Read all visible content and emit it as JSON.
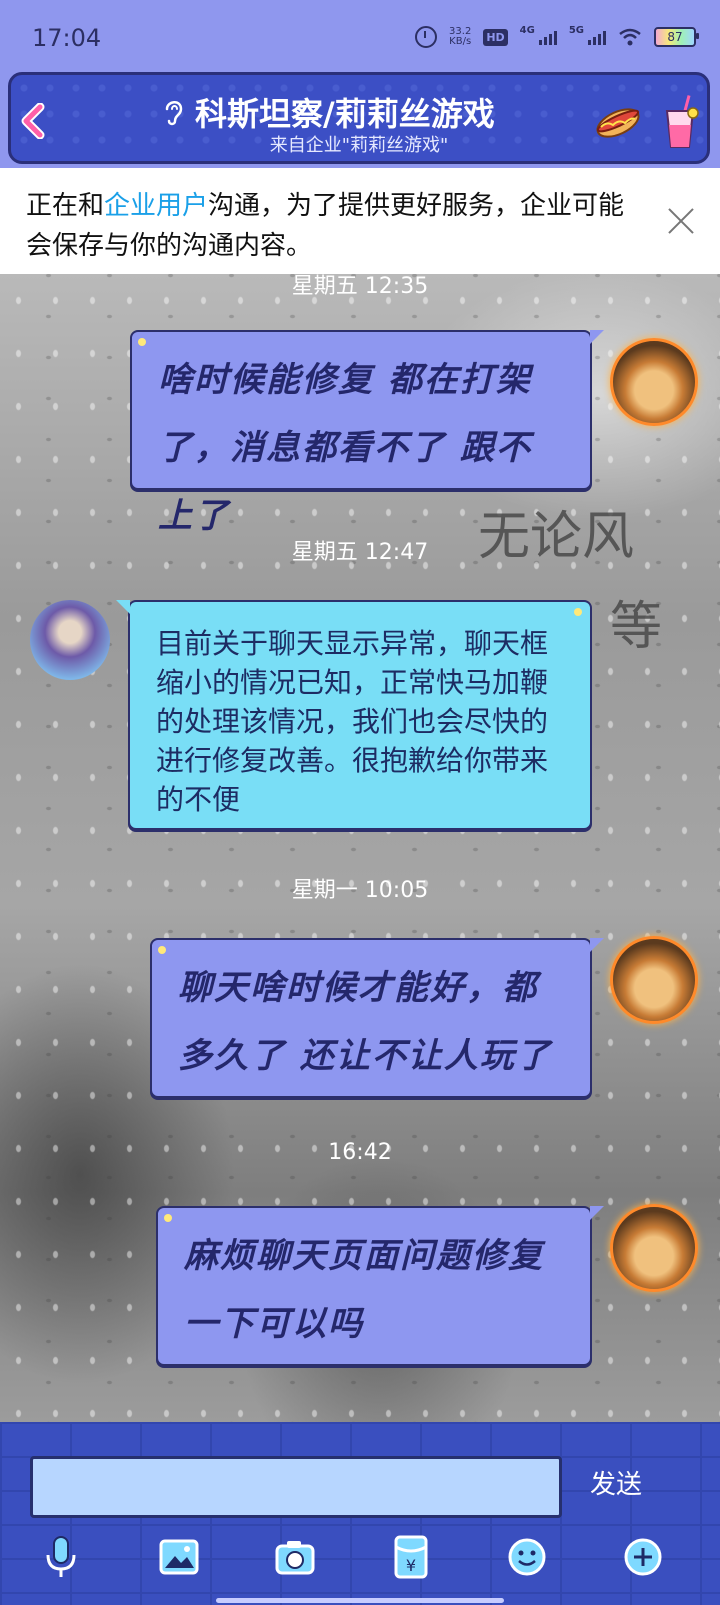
{
  "status_bar": {
    "time": "17:04",
    "net_speed_value": "33.2",
    "net_speed_unit": "KB/s",
    "hd": "HD",
    "net_4g": "4G",
    "net_5g": "5G",
    "battery": "87"
  },
  "header": {
    "title": "科斯坦察/莉莉丝游戏",
    "subtitle": "来自企业\"莉莉丝游戏\""
  },
  "notice": {
    "text_before": "正在和",
    "link": "企业用户",
    "text_after": "沟通，为了提供更好服务，企业可能会保存与你的沟通内容。"
  },
  "background_text": {
    "line1": "无论风",
    "line2": "等"
  },
  "messages": [
    {
      "timestamp": "星期五 12:35",
      "text": "啥时候能修复 都在打架了，消息都看不了 跟不上了"
    },
    {
      "timestamp": "星期五 12:47",
      "text": "目前关于聊天显示异常，聊天框缩小的情况已知，正常快马加鞭的处理该情况，我们也会尽快的进行修复改善。很抱歉给你带来的不便"
    },
    {
      "timestamp": "星期一 10:05",
      "text": "聊天啥时候才能好，都多久了 还让不让人玩了"
    },
    {
      "timestamp": "16:42",
      "text": "麻烦聊天页面问题修复一下可以吗"
    }
  ],
  "input": {
    "placeholder": "",
    "send_label": "发送"
  },
  "colors": {
    "accent": "#3c4fc5",
    "user_bubble": "#8e97f0",
    "bot_bubble": "#79def6",
    "link": "#1aa0e8"
  }
}
